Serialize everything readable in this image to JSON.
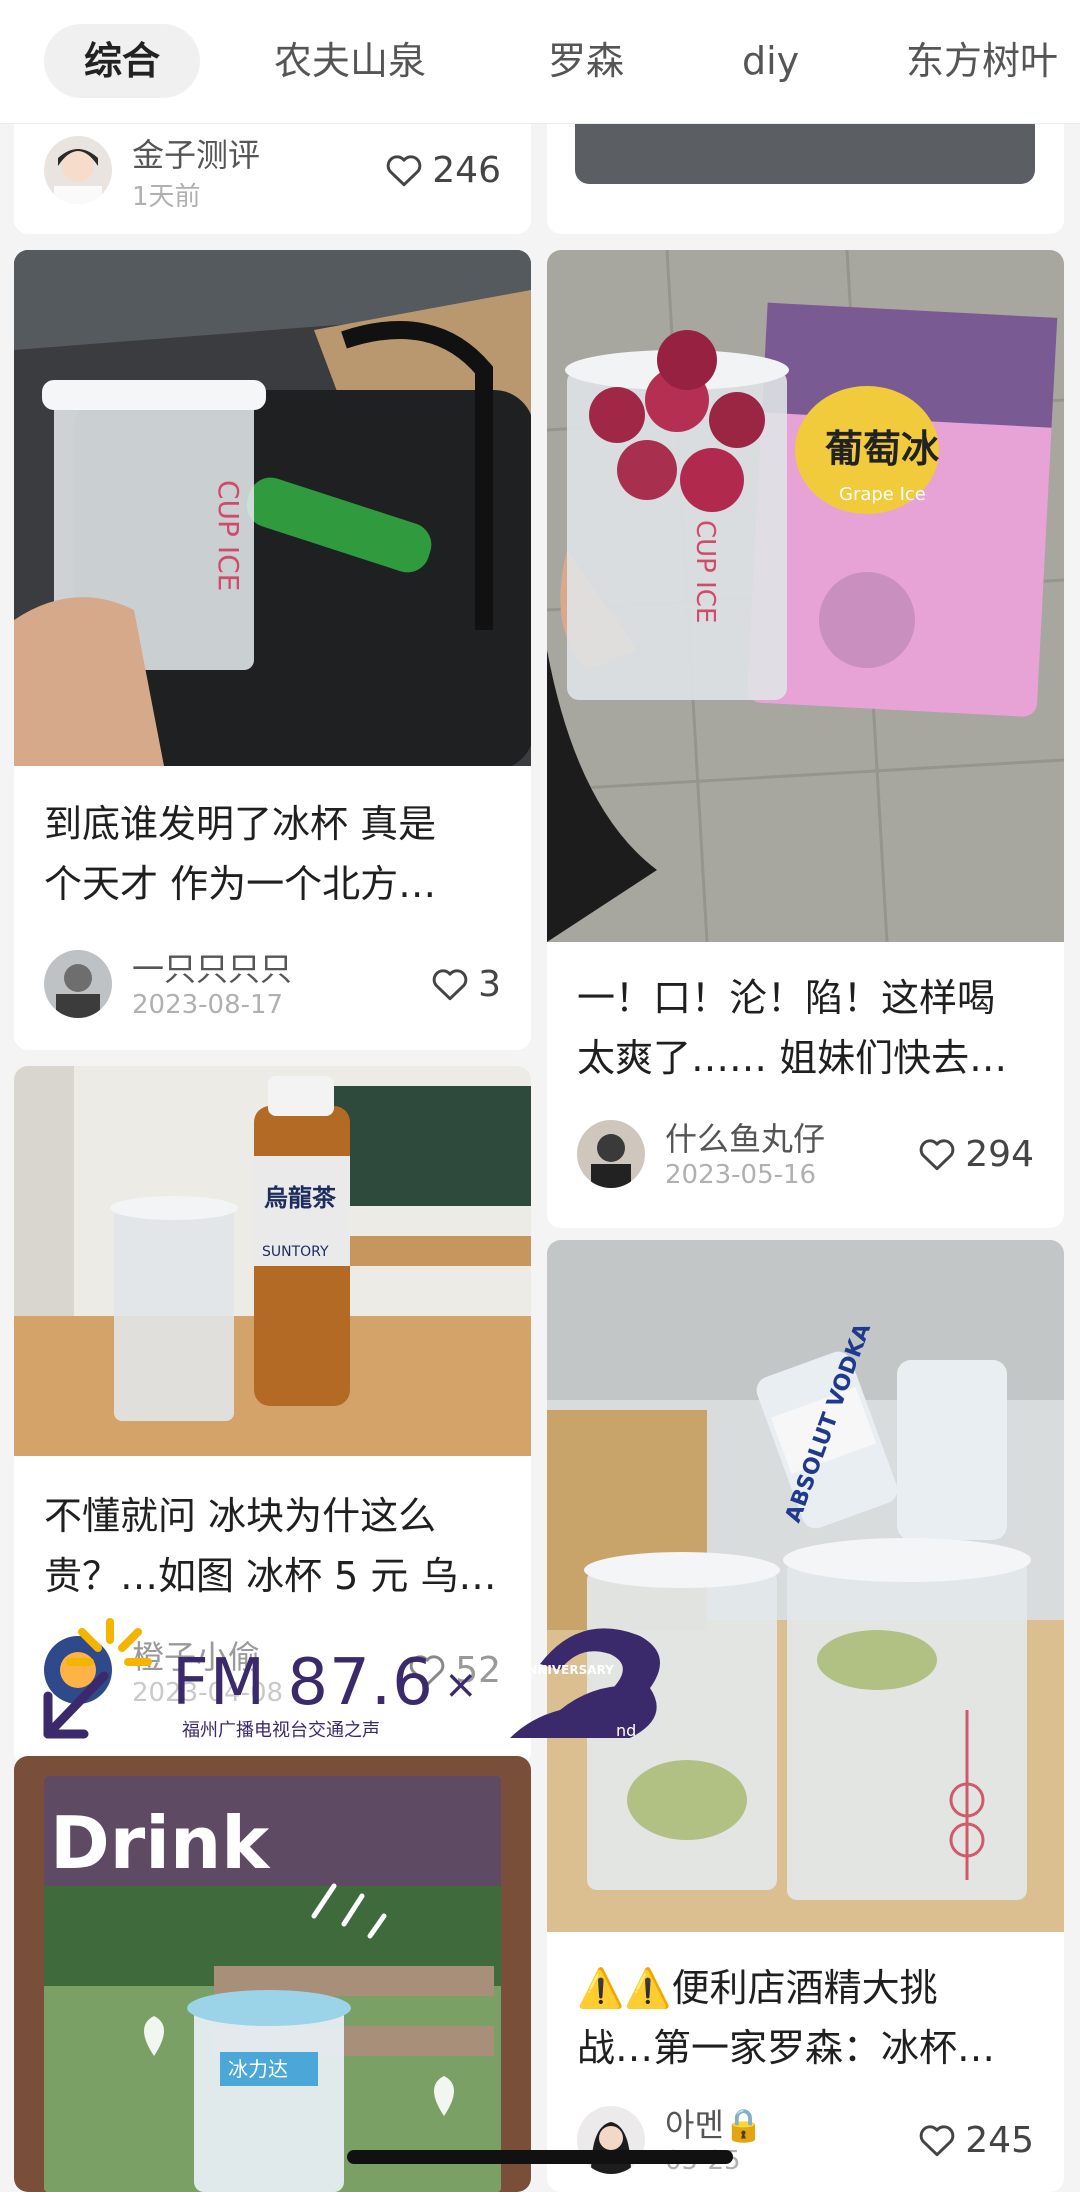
{
  "tabs": [
    "综合",
    "农夫山泉",
    "罗森",
    "diy",
    "东方树叶"
  ],
  "active_tab": "综合",
  "cards": [
    {
      "id": "top-left",
      "author": "金子测评",
      "date": "1天前",
      "likes": "246"
    },
    {
      "id": "card-1",
      "title_lines": [
        "到底谁发明了冰杯 真是",
        "个天才 作为一个北方…"
      ],
      "author": "一只只只只",
      "date": "2023-08-17",
      "likes": "3",
      "cup_text": "CUP ICE"
    },
    {
      "id": "card-2",
      "title_lines": [
        "一！口！沦！陷！这样喝",
        "太爽了…… 姐妹们快去…"
      ],
      "author": "什么鱼丸仔",
      "date": "2023-05-16",
      "likes": "294",
      "cup_text": "CUP ICE",
      "package_text": "葡萄冰",
      "package_sub": "Grape Ice"
    },
    {
      "id": "card-3",
      "title_lines": [
        "不懂就问 冰块为什这么",
        "贵？…如图 冰杯 5 元 乌…"
      ],
      "author": "橙子小偷",
      "date": "2023-04-08",
      "likes": "52",
      "bottle_label": "烏龍茶",
      "bottle_brand": "SUNTORY"
    },
    {
      "id": "card-4",
      "title_lines": [
        "⚠️⚠️便利店酒精大挑",
        "战…第一家罗森：冰杯…"
      ],
      "author": "아멘🔒",
      "date": "05-25",
      "likes": "245",
      "bottle_text": "ABSOLUT VODKA"
    },
    {
      "id": "card-5",
      "image_text": "Drink",
      "cup_label": "冰力达"
    }
  ],
  "overlay": {
    "station": "FM 87.6",
    "times": "×",
    "subtitle": "福州广播电视台交通之声",
    "anniversary": "ANNIVERSARY",
    "nd": "nd"
  },
  "colors": {
    "background": "#f4f4f4",
    "card": "#ffffff",
    "overlay_purple": "#3b2a6b",
    "overlay_yellow": "#f4b400"
  }
}
